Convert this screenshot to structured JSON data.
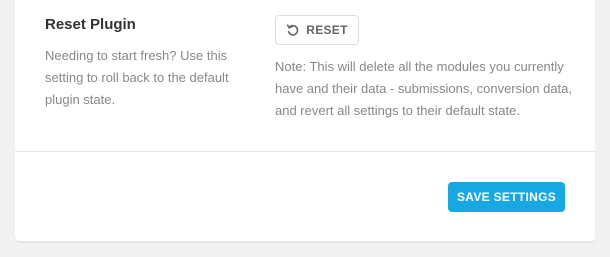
{
  "reset_section": {
    "title": "Reset Plugin",
    "description": "Needing to start fresh? Use this setting to roll back to the default plugin state.",
    "reset_button_label": "RESET",
    "reset_button_icon": "undo-icon",
    "note": "Note: This will delete all the modules you currently have and their data - submissions, conversion data, and revert all settings to their default state."
  },
  "footer": {
    "save_button_label": "SAVE SETTINGS"
  },
  "colors": {
    "accent": "#17a8e3",
    "card_background": "#ffffff",
    "page_background": "#f1f1f1"
  }
}
